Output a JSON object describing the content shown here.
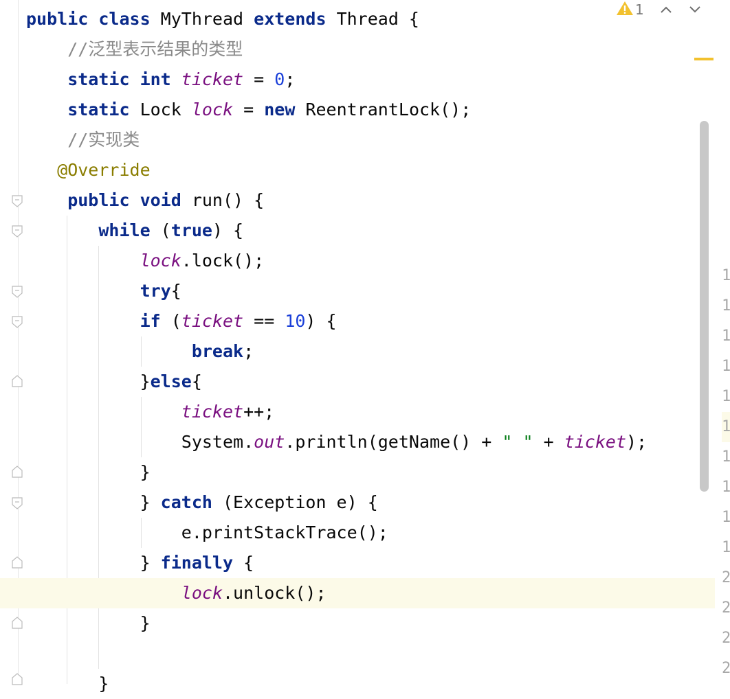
{
  "inspection": {
    "warning_count": "1"
  },
  "code_lines": [
    [
      {
        "t": "public class ",
        "c": "kw"
      },
      {
        "t": "MyThread ",
        "c": ""
      },
      {
        "t": "extends ",
        "c": "kw"
      },
      {
        "t": "Thread {",
        "c": ""
      }
    ],
    [
      {
        "t": "    //泛型表示结果的类型",
        "c": "cmt"
      }
    ],
    [
      {
        "t": "    static int ",
        "c": "kw"
      },
      {
        "t": "ticket",
        "c": "field"
      },
      {
        "t": " = ",
        "c": ""
      },
      {
        "t": "0",
        "c": "num"
      },
      {
        "t": ";",
        "c": ""
      }
    ],
    [
      {
        "t": "    static ",
        "c": "kw"
      },
      {
        "t": "Lock ",
        "c": ""
      },
      {
        "t": "lock",
        "c": "field"
      },
      {
        "t": " = ",
        "c": ""
      },
      {
        "t": "new ",
        "c": "kw"
      },
      {
        "t": "ReentrantLock();",
        "c": ""
      }
    ],
    [
      {
        "t": "    //实现类",
        "c": "cmt"
      }
    ],
    [
      {
        "t": "   @Override",
        "c": "ann"
      }
    ],
    [
      {
        "t": "    public void ",
        "c": "kw"
      },
      {
        "t": "run() {",
        "c": ""
      }
    ],
    [
      {
        "t": "       while ",
        "c": "kw"
      },
      {
        "t": "(",
        "c": ""
      },
      {
        "t": "true",
        "c": "kw"
      },
      {
        "t": ") {",
        "c": ""
      }
    ],
    [
      {
        "t": "           lock",
        "c": "field"
      },
      {
        "t": ".lock();",
        "c": ""
      }
    ],
    [
      {
        "t": "           try",
        "c": "kw"
      },
      {
        "t": "{",
        "c": ""
      }
    ],
    [
      {
        "t": "           if ",
        "c": "kw"
      },
      {
        "t": "(",
        "c": ""
      },
      {
        "t": "ticket",
        "c": "field"
      },
      {
        "t": " == ",
        "c": ""
      },
      {
        "t": "10",
        "c": "num"
      },
      {
        "t": ") {",
        "c": ""
      }
    ],
    [
      {
        "t": "                break",
        "c": "kw"
      },
      {
        "t": ";",
        "c": ""
      }
    ],
    [
      {
        "t": "           }",
        "c": ""
      },
      {
        "t": "else",
        "c": "kw"
      },
      {
        "t": "{",
        "c": ""
      }
    ],
    [
      {
        "t": "               ticket",
        "c": "field"
      },
      {
        "t": "++;",
        "c": ""
      }
    ],
    [
      {
        "t": "               System.",
        "c": ""
      },
      {
        "t": "out",
        "c": "field"
      },
      {
        "t": ".println(getName() + ",
        "c": ""
      },
      {
        "t": "\" \"",
        "c": "str"
      },
      {
        "t": " + ",
        "c": ""
      },
      {
        "t": "ticket",
        "c": "field"
      },
      {
        "t": ");",
        "c": ""
      }
    ],
    [
      {
        "t": "           }",
        "c": ""
      }
    ],
    [
      {
        "t": "           } ",
        "c": ""
      },
      {
        "t": "catch ",
        "c": "kw"
      },
      {
        "t": "(Exception e) {",
        "c": ""
      }
    ],
    [
      {
        "t": "               e.printStackTrace();",
        "c": ""
      }
    ],
    [
      {
        "t": "           } ",
        "c": ""
      },
      {
        "t": "finally ",
        "c": "kw"
      },
      {
        "t": "{",
        "c": ""
      }
    ],
    [
      {
        "t": "               lock",
        "c": "field"
      },
      {
        "t": ".unlock();",
        "c": ""
      }
    ],
    [
      {
        "t": "           }",
        "c": ""
      }
    ],
    [
      {
        "t": "",
        "c": ""
      }
    ],
    [
      {
        "t": "       }",
        "c": ""
      }
    ]
  ],
  "line_numbers_peek": [
    "1",
    "1",
    "1",
    "1",
    "1",
    "1",
    "1",
    "1",
    "1",
    "1",
    "2",
    "2",
    "2",
    "2"
  ],
  "current_line_index": 19,
  "colors": {
    "keyword": "#0a2a8a",
    "field": "#7a1080",
    "number": "#1a3fd9",
    "string": "#067d17",
    "annotation": "#8a7d00",
    "comment": "#8a8a8a",
    "warning": "#f2c12e",
    "current_line_bg": "#fcfae8"
  }
}
